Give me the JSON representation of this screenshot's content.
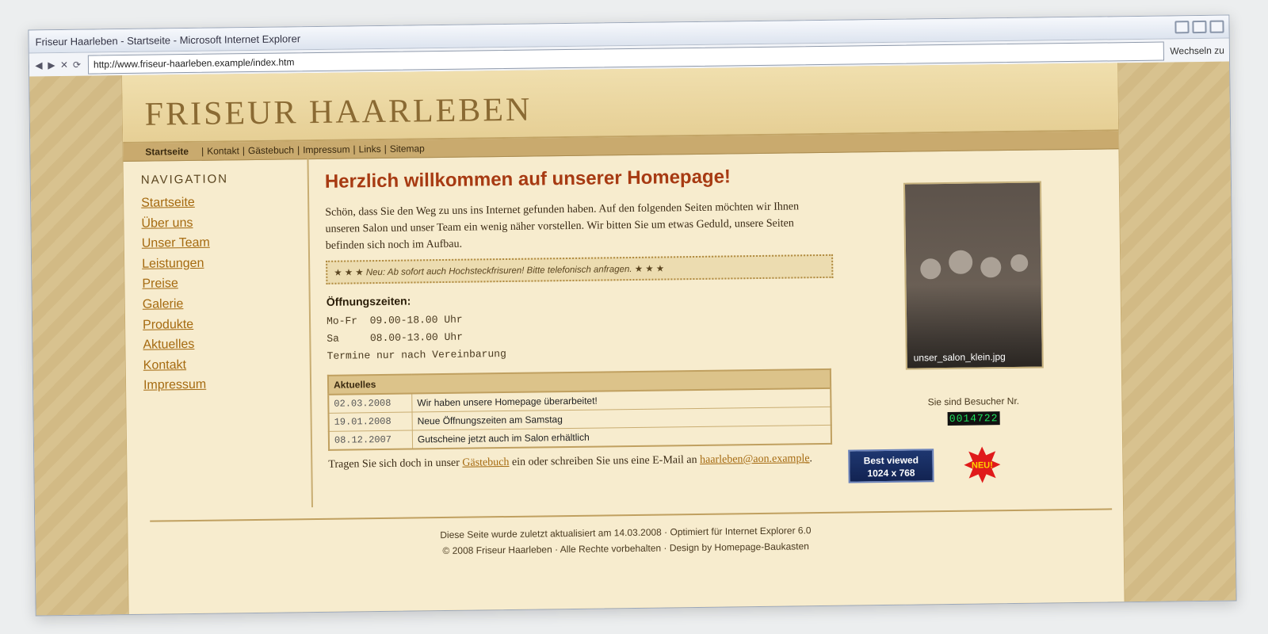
{
  "window": {
    "title": "Friseur Haarleben - Startseite - Microsoft Internet Explorer",
    "url": "http://www.friseur-haarleben.example/index.htm",
    "go_label": "Wechseln zu"
  },
  "site": {
    "logo": "FRISEUR HAARLEBEN",
    "topnav": {
      "active": "Startseite",
      "links": [
        "Kontakt",
        "Gästebuch",
        "Impressum",
        "Links",
        "Sitemap"
      ]
    }
  },
  "sidebar": {
    "heading": "NAVIGATION",
    "items": [
      "Startseite",
      "Über uns",
      "Unser Team",
      "Leistungen",
      "Preise",
      "Galerie",
      "Produkte",
      "Aktuelles",
      "Kontakt",
      "Impressum"
    ]
  },
  "main": {
    "title": "Herzlich willkommen auf unserer Homepage!",
    "intro": "Schön, dass Sie den Weg zu uns ins Internet gefunden haben. Auf den folgenden Seiten möchten wir Ihnen unseren Salon und unser Team ein wenig näher vorstellen. Wir bitten Sie um etwas Geduld, unsere Seiten befinden sich noch im Aufbau.",
    "notice": "★ ★ ★ Neu: Ab sofort auch Hochsteckfrisuren! Bitte telefonisch anfragen. ★ ★ ★",
    "hours_title": "Öffnungszeiten:",
    "hours": [
      "Mo-Fr  09.00-18.00 Uhr",
      "Sa     08.00-13.00 Uhr",
      "Termine nur nach Vereinbarung"
    ],
    "news_header": "Aktuelles",
    "news": [
      {
        "date": "02.03.2008",
        "text": "Wir haben unsere Homepage überarbeitet!"
      },
      {
        "date": "19.01.2008",
        "text": "Neue Öffnungszeiten am Samstag"
      },
      {
        "date": "08.12.2007",
        "text": "Gutscheine jetzt auch im Salon erhältlich"
      }
    ],
    "guest_pre": "Tragen Sie sich doch in unser ",
    "guest_link": "Gästebuch",
    "guest_mid": " ein oder schreiben Sie uns eine E-Mail an ",
    "email": "haarleben@aon.example",
    "guest_end": "."
  },
  "right": {
    "photo_caption": "unser_salon_klein.jpg",
    "visitor_label": "Sie sind Besucher Nr.",
    "counter": "0014722",
    "bestview_line1": "Best viewed",
    "bestview_line2": "1024 x 768",
    "neu_label": "NEU!"
  },
  "footer": {
    "line1": "Diese Seite wurde zuletzt aktualisiert am 14.03.2008  ·  Optimiert für Internet Explorer 6.0",
    "line2": "© 2008 Friseur Haarleben  ·  Alle Rechte vorbehalten  ·  Design by Homepage-Baukasten"
  }
}
